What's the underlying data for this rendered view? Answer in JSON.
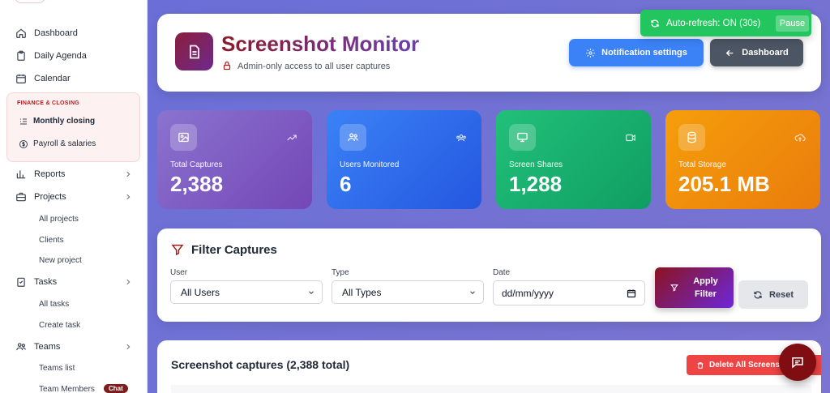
{
  "sidebar": {
    "items": [
      {
        "label": "Dashboard",
        "icon": "home-icon"
      },
      {
        "label": "Daily Agenda",
        "icon": "clipboard-icon"
      },
      {
        "label": "Calendar",
        "icon": "calendar-icon"
      }
    ],
    "finance": {
      "title": "FINANCE & CLOSING",
      "items": [
        {
          "label": "Monthly closing",
          "icon": "list-icon"
        },
        {
          "label": "Payroll & salaries",
          "icon": "dollar-icon"
        }
      ]
    },
    "reports": "Reports",
    "projects": "Projects",
    "projects_sub": [
      "All projects",
      "Clients",
      "New project"
    ],
    "tasks": "Tasks",
    "tasks_sub": [
      "All tasks",
      "Create task"
    ],
    "teams": "Teams",
    "teams_sub": [
      "Teams list",
      "Team Members"
    ],
    "chat_badge": "Chat"
  },
  "header": {
    "title": "Screenshot Monitor",
    "subtitle": "Admin-only access to all user captures",
    "notification_button": "Notification settings",
    "dashboard_button": "Dashboard"
  },
  "refresh": {
    "text": "Auto-refresh: ON (30s)",
    "pause_label": "Pause",
    "color": "#22c55e"
  },
  "stats": [
    {
      "label": "Total Captures",
      "value": "2,388",
      "color": "#7b5fc4"
    },
    {
      "label": "Users Monitored",
      "value": "6",
      "color": "#2f6ff0"
    },
    {
      "label": "Screen Shares",
      "value": "1,288",
      "color": "#16a96b"
    },
    {
      "label": "Total Storage",
      "value": "205.1 MB",
      "color": "#f08a0c"
    }
  ],
  "filter": {
    "title": "Filter Captures",
    "user_label": "User",
    "user_value": "All Users",
    "type_label": "Type",
    "type_value": "All Types",
    "date_label": "Date",
    "date_placeholder": "dd/mm/yyyy",
    "apply_label_line1": "Apply",
    "apply_label_line2": "Filter",
    "reset_label": "Reset"
  },
  "captures": {
    "title": "Screenshot captures (2,388 total)",
    "delete_label": "Delete All Screenshots"
  },
  "colors": {
    "accent": "#8b1a2b",
    "primary": "#3b82f6"
  }
}
